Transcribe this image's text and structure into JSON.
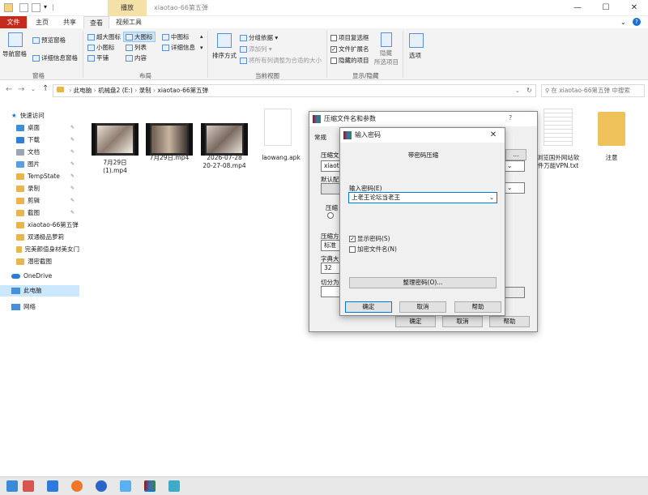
{
  "titlebar": {
    "context_tab": "播放",
    "window_title": "xiaotao-66第五弹",
    "minimize": "—",
    "maximize": "☐",
    "close": "✕"
  },
  "tabs": [
    "文件",
    "主页",
    "共享",
    "查看",
    "视频工具"
  ],
  "ribbon": {
    "pane_group": {
      "nav_pane": "导航窗格",
      "preview": "预览窗格",
      "details": "详细信息窗格",
      "label": "窗格"
    },
    "layout_group": {
      "items": [
        "超大图标",
        "大图标",
        "中图标",
        "小图标",
        "列表",
        "详细信息",
        "平铺",
        "内容"
      ],
      "label": "布局"
    },
    "view_group": {
      "sort": "排序方式",
      "group_by": "分组依据 ▾",
      "add_col": "添加列 ▾",
      "fit_cols": "将所有列调整为合适的大小",
      "label": "当前视图"
    },
    "show_group": {
      "chk1": "项目复选框",
      "chk2": "文件扩展名",
      "chk3": "隐藏的项目",
      "hide": "隐藏",
      "hide2": "所选项目",
      "label": "显示/隐藏"
    },
    "options": "选项"
  },
  "address": {
    "path": [
      "此电脑",
      "机械盘2 (E:)",
      "录制",
      "xiaotao-66第五弹"
    ],
    "search_placeholder": "在 xiaotao-66第五弹 中搜索"
  },
  "sidebar": {
    "quick_access": "快速访问",
    "items": [
      "桌面",
      "下载",
      "文档",
      "图片",
      "TempState",
      "录制",
      "剪辑",
      "截图",
      "xiaotao-66第五弹",
      "双通极品萝莉",
      "完美颜值身材美女门",
      "潜密截图"
    ],
    "onedrive": "OneDrive",
    "this_pc": "此电脑",
    "network": "网络",
    "pin": "✎"
  },
  "files": [
    {
      "name": "7月29日\n(1).mp4"
    },
    {
      "name": "7月29日.mp4"
    },
    {
      "name": "2026-07-28\n20-27-08.mp4"
    },
    {
      "name": "laowang.apk"
    },
    {
      "name": "浏览国外网站软\n件万能VPN.txt"
    },
    {
      "name": "注意"
    }
  ],
  "archive_dialog": {
    "title": "压缩文件名和参数",
    "help": "?",
    "tab": "常规",
    "labels": [
      "压缩文",
      "xiaota",
      "默认配",
      "压缩",
      "压缩方",
      "标准",
      "字典大",
      "32",
      "切分为"
    ],
    "buttons": {
      "ok": "确定",
      "cancel": "取消",
      "help": "帮助"
    }
  },
  "password_dialog": {
    "title": "输入密码",
    "close": "✕",
    "heading": "带密码压缩",
    "field_label": "输入密码(E)",
    "password": "上老王论坛当老王",
    "show_password": "显示密码(S)",
    "encrypt_names": "加密文件名(N)",
    "organize": "整理密码(O)...",
    "ok": "确定",
    "cancel": "取消",
    "help": "帮助"
  },
  "colors": {
    "file_tab": "#c42b1c",
    "context_tab": "#f5e1a8",
    "selection": "#cce8ff",
    "accent": "#0078d7"
  }
}
